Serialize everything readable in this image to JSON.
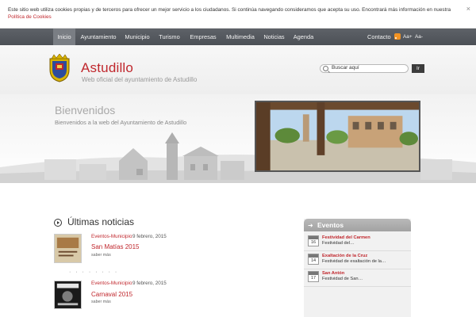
{
  "cookie_bar": {
    "text": "Este sitio web utiliza cookies propias y de terceros para ofrecer un mejor servicio a los ciudadanos. Si continúa navegando consideramos que acepta su uso. Encontrará más información en nuestra ",
    "link": "Política de Cookies",
    "close": "×"
  },
  "nav": {
    "items": [
      "Inicio",
      "Ayuntamiento",
      "Municipio",
      "Turismo",
      "Empresas",
      "Multimedia",
      "Noticias",
      "Agenda"
    ],
    "contact": "Contacto",
    "font_larger": "Aa+",
    "font_smaller": "Aa-"
  },
  "header": {
    "title": "Astudillo",
    "subtitle": "Web oficial del ayuntamiento de Astudillo",
    "search_placeholder": "Buscar aquí",
    "search_button": "Ir"
  },
  "banner": {
    "title": "Bienvenidos",
    "subtitle": "Bienvenidos a la web del Ayuntamiento de Astudillo"
  },
  "news": {
    "heading": "Últimas noticias",
    "items": [
      {
        "category": "Eventos-Municipio",
        "date": "9 febrero, 2015",
        "title": "San Matías 2015",
        "more": "saber más"
      },
      {
        "category": "Eventos-Municipio",
        "date": "9 febrero, 2015",
        "title": "Carnaval 2015",
        "more": "saber más"
      }
    ],
    "dots": "· · · · · · · ·"
  },
  "events": {
    "title": "Eventos",
    "items": [
      {
        "day": "16",
        "title": "Festividad del Carmen",
        "desc": "Festividad del…"
      },
      {
        "day": "14",
        "title": "Exaltación de la Cruz",
        "desc": "Festividad de exaltación de la…"
      },
      {
        "day": "17",
        "title": "San Antón",
        "desc": "Festividad de San…"
      }
    ]
  },
  "colors": {
    "accent": "#c0272d",
    "nav_bg": "#54585e"
  }
}
